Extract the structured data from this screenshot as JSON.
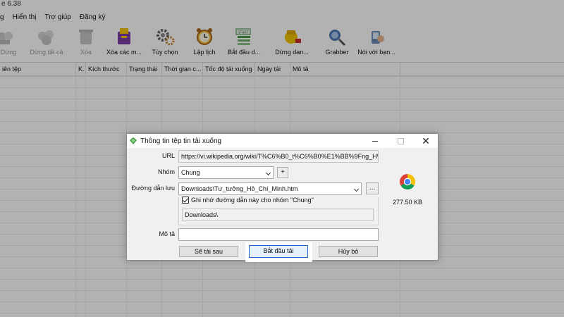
{
  "app": {
    "title_fragment": "e 6.38",
    "menu": [
      "g",
      "Hiển thị",
      "Trợ giúp",
      "Đăng ký"
    ],
    "toolbar": [
      {
        "label": "Dừng",
        "icon": "stop-icon",
        "disabled": true
      },
      {
        "label": "Dừng tất cả",
        "icon": "stop-all-icon",
        "disabled": true
      },
      {
        "label": "Xóa",
        "icon": "delete-icon",
        "disabled": true
      },
      {
        "label": "Xóa các m...",
        "icon": "delete-completed-icon",
        "disabled": false
      },
      {
        "label": "Tùy chọn",
        "icon": "gear-icon",
        "disabled": false
      },
      {
        "label": "Lập lịch",
        "icon": "alarm-clock-icon",
        "disabled": false
      },
      {
        "label": "Bắt đầu d...",
        "icon": "start-queue-icon",
        "disabled": false
      },
      {
        "label": "Dừng dan...",
        "icon": "stop-queue-icon",
        "disabled": false
      },
      {
        "label": "Grabber",
        "icon": "grabber-icon",
        "disabled": false
      },
      {
        "label": "Nói với bạn...",
        "icon": "tell-friend-icon",
        "disabled": false
      }
    ],
    "columns": [
      "iên tệp",
      "K.",
      "Kích thước",
      "Trạng thái",
      "Thời gian c...",
      "Tốc độ tải xuống",
      "Ngày tải",
      "Mô tả"
    ]
  },
  "dialog": {
    "title": "Thông tin tệp tin tải xuống",
    "url_label": "URL",
    "url_value": "https://vi.wikipedia.org/wiki/T%C6%B0_t%C6%B0%E1%BB%9Fng_H%E",
    "group_label": "Nhóm",
    "group_value": "Chung",
    "add_group_label": "+",
    "save_path_label": "Đường dẫn lưu",
    "save_path_value": "Downloads\\Tư_tưởng_Hồ_Chí_Minh.htm",
    "browse_label": "...",
    "remember_label": "Ghi nhớ đường dẫn này cho nhóm \"Chung\"",
    "remember_checked": true,
    "folder_value": "Downloads\\",
    "desc_label": "Mô tả",
    "desc_value": "",
    "file_size": "277.50  KB",
    "buttons": {
      "later": "Sẽ tải sau",
      "start": "Bắt đầu tải",
      "cancel": "Hủy bỏ"
    }
  },
  "colors": {
    "overlay": "#000000",
    "focus_border": "#1f66c9",
    "chrome_red": "#db4437",
    "chrome_yellow": "#f4c20d",
    "chrome_green": "#0f9d58",
    "chrome_blue": "#4285f4"
  }
}
